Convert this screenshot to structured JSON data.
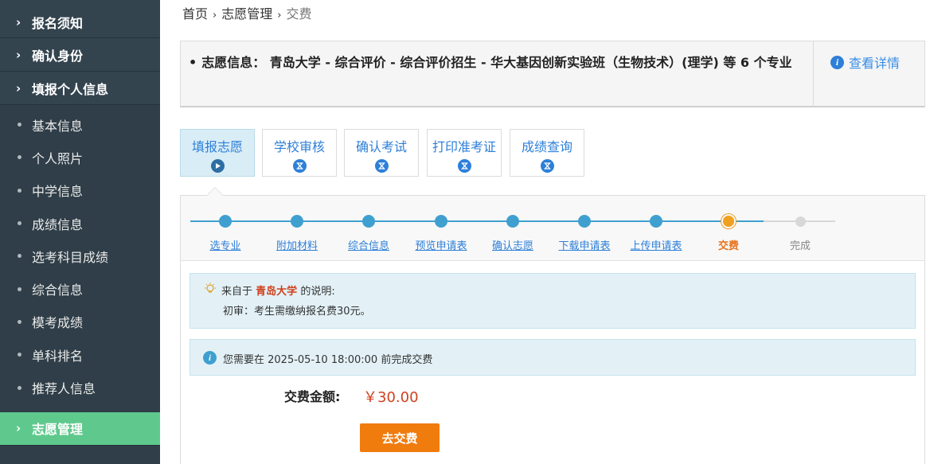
{
  "sidebar": {
    "sections_top": [
      {
        "label": "报名须知"
      },
      {
        "label": "确认身份"
      },
      {
        "label": "填报个人信息"
      }
    ],
    "sub_items": [
      {
        "label": "基本信息"
      },
      {
        "label": "个人照片"
      },
      {
        "label": "中学信息"
      },
      {
        "label": "成绩信息"
      },
      {
        "label": "选考科目成绩"
      },
      {
        "label": "综合信息"
      },
      {
        "label": "模考成绩"
      },
      {
        "label": "单科排名"
      },
      {
        "label": "推荐人信息"
      }
    ],
    "active_section": {
      "label": "志愿管理"
    },
    "colors": {
      "background": "#2f3e48",
      "active": "#5fc98d"
    }
  },
  "breadcrumb": {
    "items": [
      "首页",
      "志愿管理",
      "交费"
    ],
    "separator": "›"
  },
  "info": {
    "bullet": "•",
    "text": "志愿信息：  青岛大学 - 综合评价 - 综合评价招生 - 华大基因创新实验班（生物技术）(理学) 等 6 个专业",
    "link_icon": "i",
    "link_label": "查看详情"
  },
  "tabs": [
    {
      "label": "填报志愿",
      "icon": "play-icon",
      "active": true
    },
    {
      "label": "学校审核",
      "icon": "hourglass-icon",
      "active": false
    },
    {
      "label": "确认考试",
      "icon": "hourglass-icon",
      "active": false
    },
    {
      "label": "打印准考证",
      "icon": "hourglass-icon",
      "active": false
    },
    {
      "label": "成绩查询",
      "icon": "hourglass-icon",
      "active": false
    }
  ],
  "steps": [
    {
      "label": "选专业",
      "state": "done"
    },
    {
      "label": "附加材料",
      "state": "done"
    },
    {
      "label": "综合信息",
      "state": "done"
    },
    {
      "label": "预览申请表",
      "state": "done"
    },
    {
      "label": "确认志愿",
      "state": "done"
    },
    {
      "label": "下载申请表",
      "state": "done"
    },
    {
      "label": "上传申请表",
      "state": "done"
    },
    {
      "label": "交费",
      "state": "current"
    },
    {
      "label": "完成",
      "state": "future"
    }
  ],
  "notice_school": {
    "prefix": "来自于",
    "school": "青岛大学",
    "suffix": "的说明:",
    "body": "初审：考生需缴纳报名费30元。"
  },
  "notice_deadline": {
    "icon": "i",
    "text": "您需要在 2025-05-10 18:00:00 前完成交费"
  },
  "fee": {
    "label": "交费金额:",
    "amount": "￥30.00",
    "button": "去交费"
  }
}
